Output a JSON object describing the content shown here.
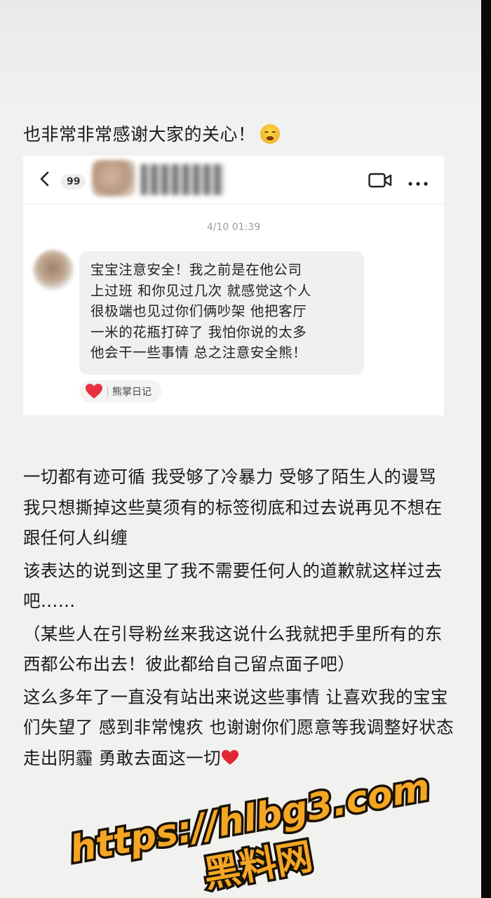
{
  "intro": {
    "text": "也非常非常感谢大家的关心！",
    "emoji": "loudly-crying-face"
  },
  "chat": {
    "unread_badge": "99",
    "timestamp": "4/10 01:39",
    "message": "宝宝注意安全！我之前是在他公司\n上过班 和你见过几次 就感觉这个人\n很极端也见过你们俩吵架 他把客厅\n一米的花瓶打碎了 我怕你说的太多\n他会干一些事情 总之注意安全熊！",
    "reaction": {
      "icon": "heart",
      "name": "熊掌日记"
    }
  },
  "body": {
    "paragraphs": [
      " 一切都有迹可循 我受够了冷暴力 受够了陌生人的谩骂 我只想撕掉这些莫须有的标签彻底和过去说再见不想在跟任何人纠缠",
      "该表达的说到这里了我不需要任何人的道歉就这样过去吧……",
      " （某些人在引导粉丝来我这说什么我就把手里所有的东西都公布出去！彼此都给自己留点面子吧）",
      "这么多年了一直没有站出来说这些事情 让喜欢我的宝宝们失望了  感到非常愧疚  也谢谢你们愿意等我调整好状态走出阴霾 勇敢去面这一切"
    ],
    "end_icon": "red-heart"
  },
  "watermark": {
    "line1": "https://hlbg3.com",
    "line2": "黑料网",
    "fill": "#f5a623",
    "outline": "#1a1206"
  }
}
